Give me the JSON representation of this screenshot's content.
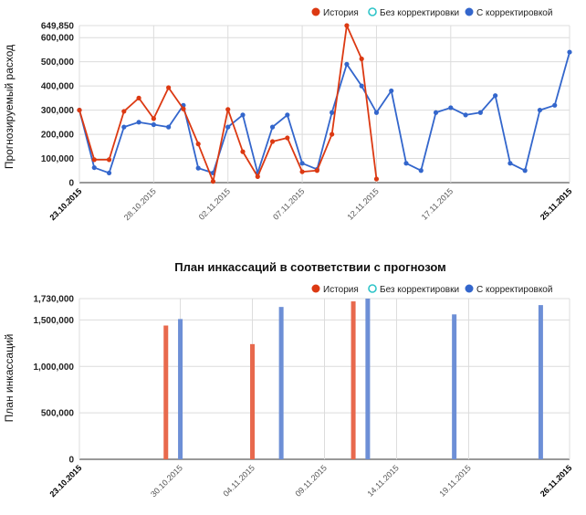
{
  "legend": {
    "history": "История",
    "no_correction": "Без корректировки",
    "with_correction": "С корректировкой"
  },
  "colors": {
    "history": "#dc3912",
    "with_correction": "#3366cc",
    "no_correction": "#2ec4c8",
    "history_bar": "#e8694d",
    "with_correction_bar": "#6d8fd6"
  },
  "chart_data": [
    {
      "type": "line",
      "title": "",
      "ylabel": "Прогнозируемый расход",
      "ylim": [
        0,
        649850
      ],
      "y_ticks": [
        "0",
        "100,000",
        "200,000",
        "300,000",
        "400,000",
        "500,000",
        "600,000",
        "649,850"
      ],
      "x_tick_labels": [
        "23.10.2015",
        "28.10.2015",
        "02.11.2015",
        "07.11.2015",
        "12.11.2015",
        "17.11.2015",
        "25.11.2015"
      ],
      "series": [
        {
          "name": "История",
          "x": [
            "23.10.2015",
            "24.10.2015",
            "25.10.2015",
            "26.10.2015",
            "27.10.2015",
            "28.10.2015",
            "29.10.2015",
            "30.10.2015",
            "31.10.2015",
            "01.11.2015",
            "02.11.2015",
            "03.11.2015",
            "04.11.2015",
            "05.11.2015",
            "06.11.2015",
            "07.11.2015",
            "08.11.2015",
            "09.11.2015",
            "10.11.2015",
            "11.11.2015",
            "12.11.2015",
            "13.11.2015"
          ],
          "values": [
            300000,
            95000,
            95000,
            295000,
            350000,
            265000,
            393000,
            305000,
            160000,
            5000,
            303000,
            128000,
            25000,
            170000,
            185000,
            45000,
            50000,
            200000,
            649850,
            512000,
            15000,
            null
          ]
        },
        {
          "name": "С корректировкой",
          "x": [
            "23.10.2015",
            "24.10.2015",
            "25.10.2015",
            "26.10.2015",
            "27.10.2015",
            "28.10.2015",
            "29.10.2015",
            "30.10.2015",
            "31.10.2015",
            "01.11.2015",
            "02.11.2015",
            "03.11.2015",
            "04.11.2015",
            "05.11.2015",
            "06.11.2015",
            "07.11.2015",
            "08.11.2015",
            "09.11.2015",
            "10.11.2015",
            "11.11.2015",
            "12.11.2015",
            "13.11.2015",
            "14.11.2015",
            "15.11.2015",
            "16.11.2015",
            "17.11.2015",
            "18.11.2015",
            "19.11.2015",
            "20.11.2015",
            "21.11.2015",
            "22.11.2015",
            "23.11.2015",
            "24.11.2015",
            "25.11.2015"
          ],
          "values": [
            300000,
            62000,
            40000,
            230000,
            250000,
            240000,
            230000,
            320000,
            60000,
            40000,
            230000,
            280000,
            40000,
            230000,
            280000,
            80000,
            55000,
            290000,
            490000,
            400000,
            290000,
            380000,
            80000,
            50000,
            290000,
            310000,
            280000,
            290000,
            360000,
            80000,
            50000,
            300000,
            320000,
            540000
          ]
        },
        {
          "name": "Без корректировки",
          "values": []
        }
      ]
    },
    {
      "type": "bar",
      "title": "План инкассаций в соответствии с прогнозом",
      "ylabel": "План инкассаций",
      "ylim": [
        0,
        1730000
      ],
      "y_ticks": [
        "0",
        "500,000",
        "1,000,000",
        "1,500,000",
        "1,730,000"
      ],
      "x_tick_labels": [
        "23.10.2015",
        "30.10.2015",
        "04.11.2015",
        "09.11.2015",
        "14.11.2015",
        "19.11.2015",
        "26.11.2015"
      ],
      "series": [
        {
          "name": "История",
          "x": [
            "29.10.2015",
            "04.11.2015",
            "11.11.2015"
          ],
          "values": [
            1440000,
            1240000,
            1700000
          ]
        },
        {
          "name": "С корректировкой",
          "x": [
            "30.10.2015",
            "06.11.2015",
            "12.11.2015",
            "18.11.2015",
            "24.11.2015"
          ],
          "values": [
            1510000,
            1640000,
            1730000,
            1560000,
            1660000
          ]
        },
        {
          "name": "Без корректировки",
          "values": []
        }
      ]
    }
  ]
}
